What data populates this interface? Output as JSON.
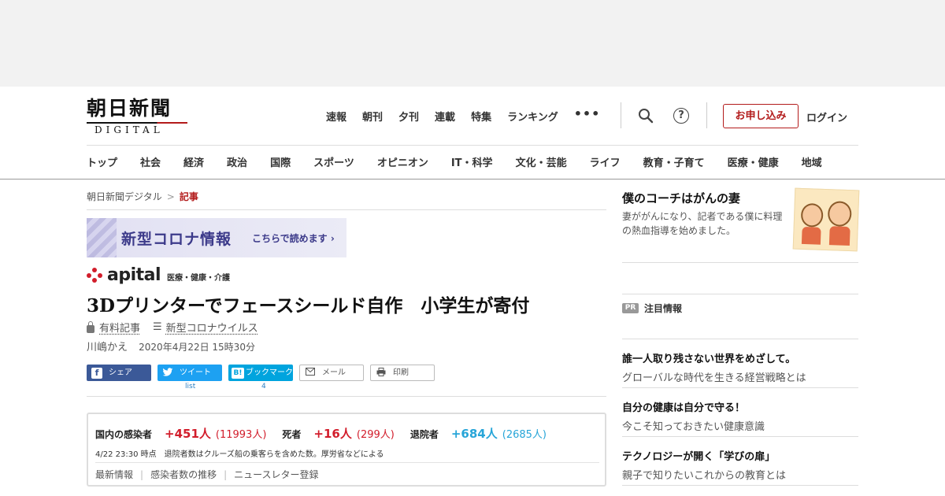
{
  "header": {
    "logo_main": "朝日新聞",
    "logo_sub": "DIGITAL",
    "top_nav": [
      "速報",
      "朝刊",
      "夕刊",
      "連載",
      "特集",
      "ランキング"
    ],
    "more_label": "•••",
    "help_label": "?",
    "apply_label": "お申し込み",
    "login_label": "ログイン",
    "categories": [
      "トップ",
      "社会",
      "経済",
      "政治",
      "国際",
      "スポーツ",
      "オピニオン",
      "IT・科学",
      "文化・芸能",
      "ライフ",
      "教育・子育て",
      "医療・健康",
      "地域"
    ]
  },
  "breadcrumb": {
    "home": "朝日新聞デジタル",
    "separator": ">",
    "current": "記事"
  },
  "corona_banner": {
    "title": "新型コロナ情報",
    "link": "こちらで読めます ›"
  },
  "apital": {
    "word": "apital",
    "category": "医療・健康・介護"
  },
  "article": {
    "headline": "3Dプリンターでフェースシールド自作　小学生が寄付",
    "paid_label": "有料記事",
    "topic_label": "新型コロナウイルス",
    "author": "川嶋かえ",
    "date": "2020年4月22日 15時30分"
  },
  "share": {
    "facebook": "シェア",
    "twitter": "ツイート",
    "hatena": "ブックマーク",
    "mail": "メール",
    "print": "印刷",
    "twitter_count": "list",
    "hatena_count": "4"
  },
  "covid_stats": {
    "infected_label": "国内の感染者",
    "infected_new": "+451人",
    "infected_total": "(11993人)",
    "deaths_label": "死者",
    "deaths_new": "+16人",
    "deaths_total": "(299人)",
    "discharged_label": "退院者",
    "discharged_new": "+684人",
    "discharged_total": "(2685人)",
    "note": "4/22 23:30 時点　退院者数はクルーズ船の乗客らを含めた数。厚労省などによる",
    "links": [
      "最新情報",
      "感染者数の推移",
      "ニュースレター登録"
    ],
    "colors": {
      "red": "#d21d2b",
      "blue": "#27a5d8"
    }
  },
  "sidebar": {
    "promo": {
      "title": "僕のコーチはがんの妻",
      "desc": "妻ががんになり、記者である僕に料理の熱血指導を始めました。"
    },
    "pr_badge": "PR",
    "pr_title": "注目情報",
    "pr_items": [
      {
        "title": "誰一人取り残さない世界をめざして。",
        "desc": "グローバルな時代を生きる経営戦略とは"
      },
      {
        "title": "自分の健康は自分で守る！",
        "desc": "今こそ知っておきたい健康意識"
      },
      {
        "title": "テクノロジーが開く「学びの扉」",
        "desc": "親子で知りたいこれからの教育とは"
      }
    ]
  },
  "colors": {
    "brand_red": "#b31b1b"
  }
}
